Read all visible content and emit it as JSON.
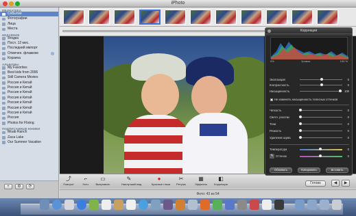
{
  "window": {
    "title": "iPhoto"
  },
  "sidebar": {
    "library_header": "МЕДИАТЕКА",
    "library_items": [
      "События",
      "Фотографии",
      "Лица",
      "Места"
    ],
    "recent_header": "НЕДАВНИЕ",
    "recent_items": [
      "Ягодка",
      "Посл. 12 мес.",
      "Последний импорт",
      "Отмечен. флажком",
      "Корзина"
    ],
    "albums_header": "АЛЬБОМЫ",
    "album_items": [
      "My Favorites",
      "Best kids from 2006",
      "Still Camera Movies",
      "Россия и Китай",
      "Россия и Китай",
      "Россия и Китай",
      "Россия и Китай",
      "Россия и Китай",
      "Россия и Китай",
      "Россия и Китай",
      "Россия",
      "Photos for Flixing"
    ],
    "subscribed_header": "ПОДПИСАННЫЕ ЮНИЕИ",
    "subscribed_items": [
      "Moab Ranch",
      "Zaca Lake",
      "Our Summer Vacation"
    ],
    "bottom_buttons": [
      "+",
      "⚙",
      "⟳"
    ]
  },
  "toolbar": {
    "tools": [
      {
        "icon": "⤴",
        "label": "Поворот"
      },
      {
        "icon": "⌐",
        "label": "Усеч."
      },
      {
        "icon": "▭",
        "label": "Выпрямить"
      },
      {
        "icon": "✎",
        "label": "Наилучший вид"
      },
      {
        "icon": "●",
        "label": "Красные глаза"
      },
      {
        "icon": "✂",
        "label": "Ретушь"
      },
      {
        "icon": "▦",
        "label": "Эффекты"
      },
      {
        "icon": "◧",
        "label": "Коррекция"
      }
    ],
    "done_label": "Готово",
    "prev_icon": "◀",
    "next_icon": "▶"
  },
  "status": {
    "text": "Фото: 43 из 54"
  },
  "hud": {
    "title": "Коррекция",
    "hist_left": "0%",
    "hist_center": "Уровни",
    "hist_right": "100 %",
    "rows_top": [
      {
        "label": "Экспозиция",
        "value": "0",
        "level": 0.55
      },
      {
        "label": "Контрастность",
        "value": "0",
        "level": 0.55
      },
      {
        "label": "Насыщенность",
        "value": "100",
        "level": 0.95
      }
    ],
    "checkbox_label": "Не изменять насыщенность телесных оттенков",
    "rows_mid": [
      {
        "label": "Четкость",
        "value": "0",
        "level": 0.0
      },
      {
        "label": "Светл. участки",
        "value": "0",
        "level": 0.0
      },
      {
        "label": "Тени",
        "value": "0",
        "level": 0.0
      },
      {
        "label": "Резкость",
        "value": "0",
        "level": 0.0
      },
      {
        "label": "Удаление шума",
        "value": "0",
        "level": 0.0
      }
    ],
    "rows_bottom": [
      {
        "label": "Температура",
        "value": "0",
        "level": 0.5
      },
      {
        "label": "Оттенок",
        "value": "0",
        "level": 0.5
      }
    ],
    "buttons": [
      "Обновить",
      "Копировать",
      "Вставить"
    ]
  },
  "filmstrip": {
    "count": 10,
    "selected": 3
  }
}
